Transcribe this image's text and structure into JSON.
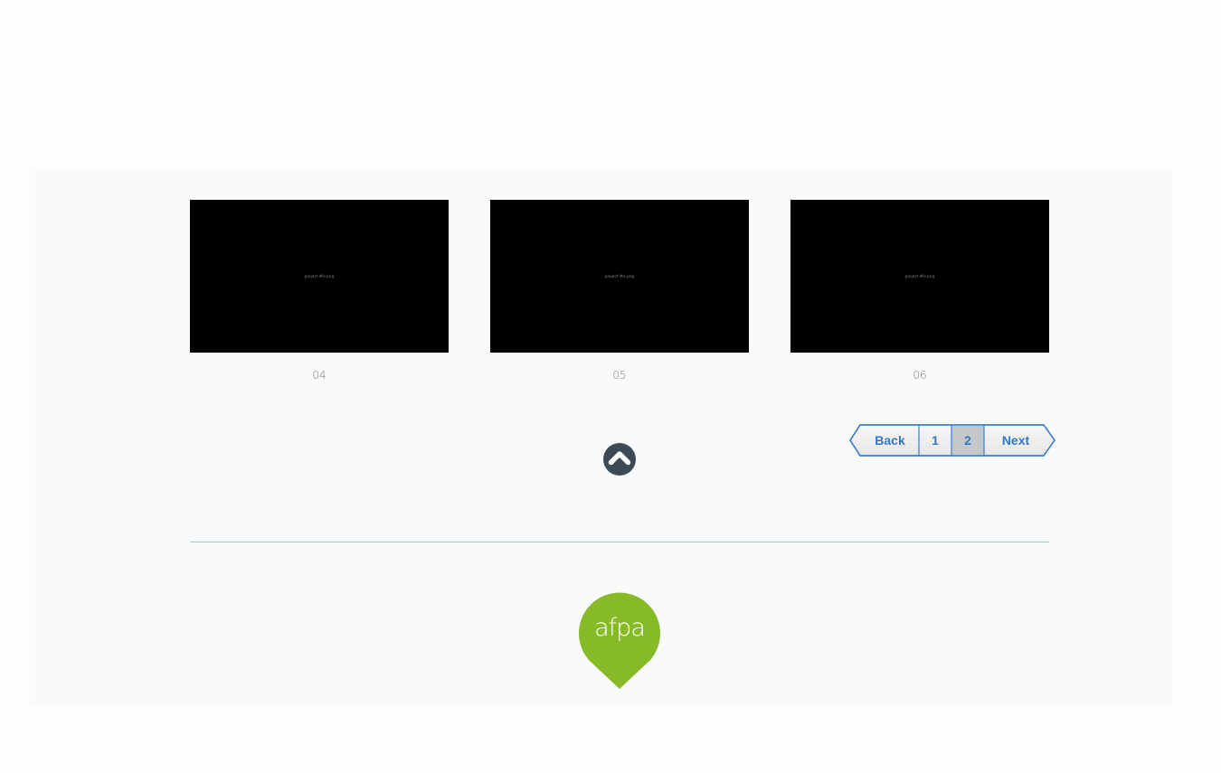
{
  "gallery": {
    "items": [
      {
        "image_label": "project-#ls.png",
        "caption": "04"
      },
      {
        "image_label": "project-#ls.png",
        "caption": "05"
      },
      {
        "image_label": "project-#ls.png",
        "caption": "06"
      }
    ]
  },
  "pagination": {
    "back_label": "Back",
    "pages": [
      "1",
      "2"
    ],
    "current_page": "2",
    "next_label": "Next"
  },
  "scroll_top": {
    "icon": "chevron-up-icon"
  },
  "footer": {
    "logo_text": "afpa",
    "colors": {
      "logo_green": "#86bb27",
      "divider": "#9cc7e8",
      "pager_blue": "#2f78c4"
    }
  }
}
